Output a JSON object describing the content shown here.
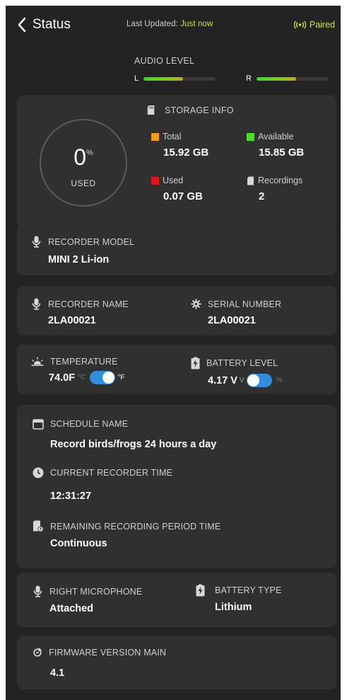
{
  "header": {
    "back_label": "Status",
    "last_updated_label": "Last Updated:",
    "last_updated_value": "Just now",
    "paired_label": "Paired"
  },
  "audio": {
    "title": "AUDIO LEVEL",
    "left_label": "L",
    "right_label": "R",
    "left_level_fraction": 0.55,
    "right_level_fraction": 0.55
  },
  "storage": {
    "title": "STORAGE INFO",
    "used_percent": "0",
    "percent_symbol": "%",
    "used_caption": "USED",
    "total_label": "Total",
    "total_value": "15.92 GB",
    "available_label": "Available",
    "available_value": "15.85 GB",
    "used_label": "Used",
    "used_value": "0.07 GB",
    "recordings_label": "Recordings",
    "recordings_value": "2",
    "colors": {
      "total": "#f39c1f",
      "available": "#3fe61a",
      "used": "#e3151c"
    }
  },
  "recorder_model": {
    "label": "RECORDER MODEL",
    "value": "MINI 2 Li-ion",
    "icon": "microphone-icon"
  },
  "recorder_name": {
    "label": "RECORDER NAME",
    "value": "2LA00021",
    "icon": "microphone-icon"
  },
  "serial_number": {
    "label": "SERIAL NUMBER",
    "value": "2LA00021",
    "icon": "gear-icon"
  },
  "temperature": {
    "label": "TEMPERATURE",
    "value": "74.0F",
    "unit_off": "°C",
    "unit_on": "°F",
    "toggle_on": true,
    "icon": "sunrise-icon"
  },
  "battery_level": {
    "label": "BATTERY LEVEL",
    "value": "4.17 V",
    "unit_on": "V",
    "unit_off": "%",
    "toggle_on": false,
    "icon": "battery-icon"
  },
  "schedule": {
    "name_label": "SCHEDULE NAME",
    "name_value": "Record birds/frogs 24 hours a day",
    "time_label": "CURRENT RECORDER TIME",
    "time_value": "12:31:27",
    "remaining_label": "REMAINING RECORDING PERIOD TIME",
    "remaining_value": "Continuous"
  },
  "microphone": {
    "label": "RIGHT MICROPHONE",
    "value": "Attached",
    "icon": "microphone-icon"
  },
  "battery_type": {
    "label": "BATTERY TYPE",
    "value": "Lithium",
    "icon": "battery-icon"
  },
  "firmware": {
    "label": "FIRMWARE VERSION MAIN",
    "value": "4.1",
    "icon": "sync-icon"
  },
  "accent_color": "#c9e63a",
  "toggle_color": "#2f8ee0"
}
